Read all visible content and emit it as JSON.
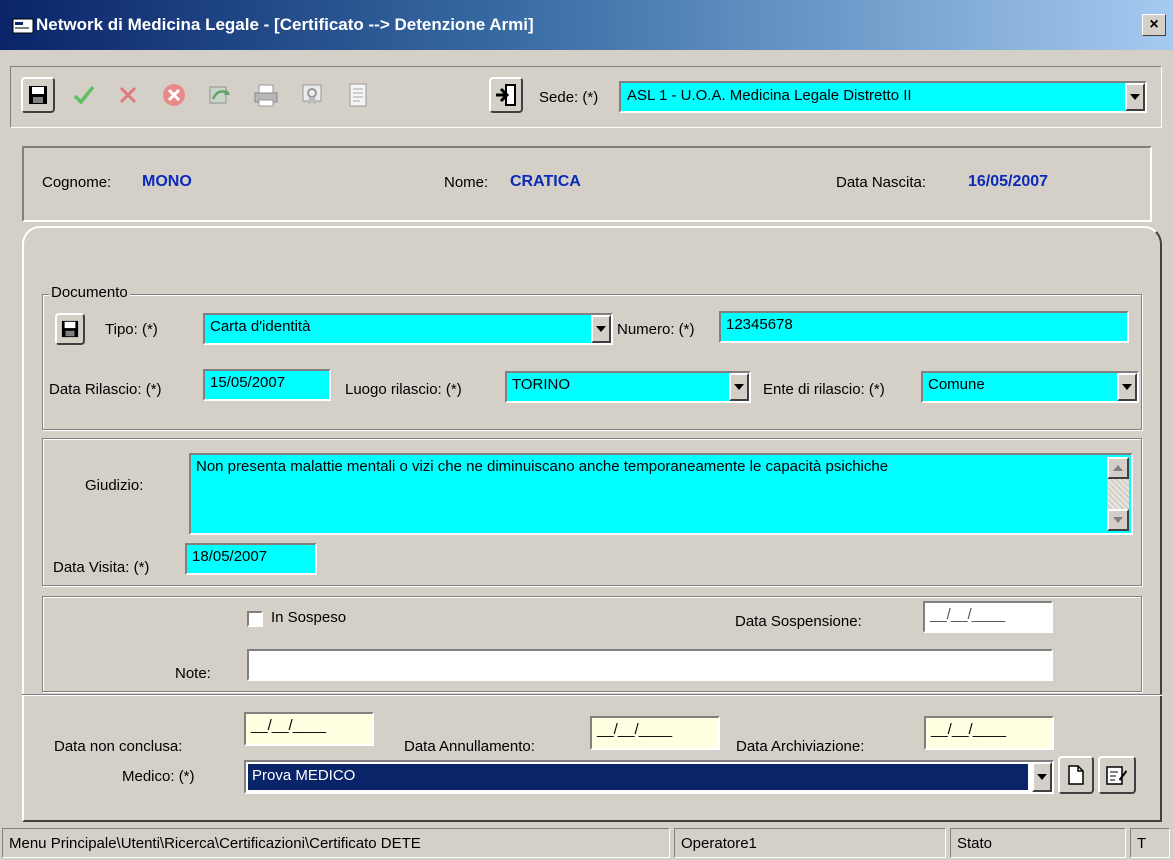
{
  "window": {
    "title": "Network di Medicina Legale - [Certificato --> Detenzione Armi]",
    "close_glyph": "×"
  },
  "toolbar": {
    "buttons": [
      "save-icon",
      "confirm-check-icon",
      "cancel-x-icon",
      "delete-circle-icon",
      "refresh-icon",
      "print-icon",
      "certificate-icon",
      "document-icon",
      "exit-door-icon"
    ],
    "sede_label": "Sede: (*)",
    "sede_value": "ASL 1 - U.O.A. Medicina Legale Distretto II"
  },
  "patient": {
    "cognome_label": "Cognome:",
    "cognome_value": "MONO",
    "nome_label": "Nome:",
    "nome_value": "CRATICA",
    "nascita_label": "Data Nascita:",
    "nascita_value": "16/05/2007"
  },
  "documento": {
    "caption": "Documento",
    "tipo_label": "Tipo: (*)",
    "tipo_value": "Carta d'identità",
    "numero_label": "Numero: (*)",
    "numero_value": "12345678",
    "data_rilascio_label": "Data Rilascio: (*)",
    "data_rilascio_value": "15/05/2007",
    "luogo_label": "Luogo rilascio: (*)",
    "luogo_value": "TORINO",
    "ente_label": "Ente di rilascio: (*)",
    "ente_value": "Comune"
  },
  "giudizio": {
    "label": "Giudizio:",
    "value": "Non presenta malattie mentali o vizi che ne diminuiscano anche temporaneamente le capacità psichiche",
    "data_visita_label": "Data Visita: (*)",
    "data_visita_value": "18/05/2007"
  },
  "sospensione": {
    "in_sospeso_label": "In Sospeso",
    "in_sospeso_checked": false,
    "data_sospensione_label": "Data Sospensione:",
    "data_sospensione_value": "__/__/____",
    "note_label": "Note:",
    "note_value": ""
  },
  "chiusura": {
    "data_non_conclusa_label": "Data non conclusa:",
    "data_non_conclusa_value": "__/__/____",
    "data_annullamento_label": "Data Annullamento:",
    "data_annullamento_value": "__/__/____",
    "data_archiviazione_label": "Data Archiviazione:",
    "data_archiviazione_value": "__/__/____",
    "medico_label": "Medico:  (*)",
    "medico_value": "Prova MEDICO"
  },
  "statusbar": {
    "path": "Menu Principale\\Utenti\\Ricerca\\Certificazioni\\Certificato DETE",
    "operatore": "Operatore1",
    "stato": "Stato",
    "extra": "T"
  },
  "colors": {
    "field_cyan": "#00ffff",
    "field_yellow": "#ffffe1",
    "patient_value_blue": "#0b2ab8",
    "selection_navy": "#0a246a"
  }
}
